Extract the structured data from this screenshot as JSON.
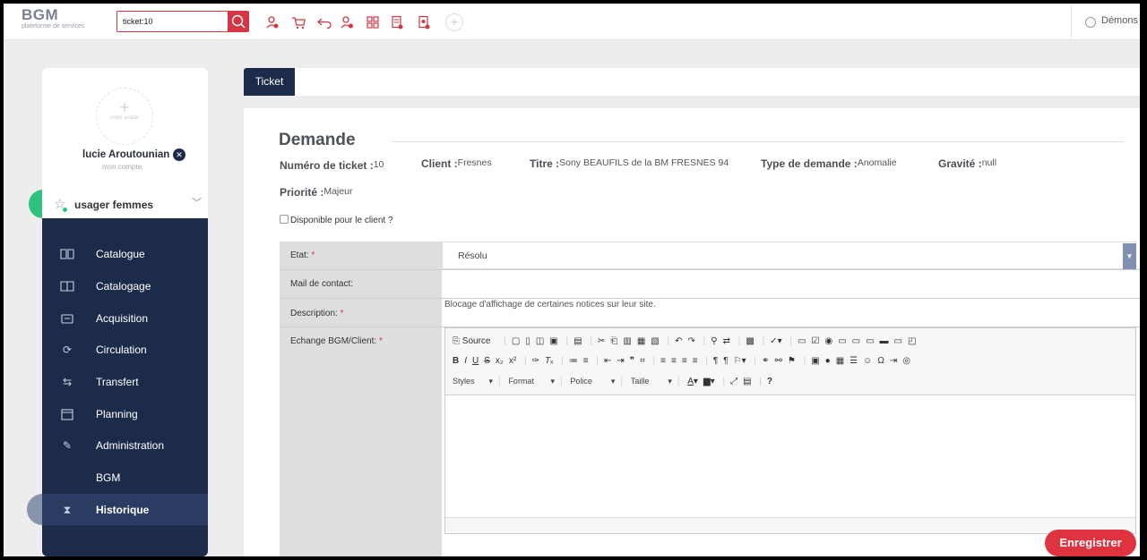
{
  "header": {
    "logo_title": "BGM",
    "logo_subtitle": "plateforme de services",
    "search_value": "ticket:10",
    "user_label": "Démons",
    "colors": {
      "accent": "#d43744",
      "navy": "#1d2b4a"
    }
  },
  "sidebar": {
    "avatar_label": "votre avatar",
    "user_name": "lucie Aroutounian",
    "account_label": "mon compte",
    "profile": "usager femmes",
    "items": [
      {
        "label": "Catalogue",
        "icon": "book-open-icon"
      },
      {
        "label": "Catalogage",
        "icon": "book-icon"
      },
      {
        "label": "Acquisition",
        "icon": "wallet-icon"
      },
      {
        "label": "Circulation",
        "icon": "refresh-icon"
      },
      {
        "label": "Transfert",
        "icon": "transfer-icon"
      },
      {
        "label": "Planning",
        "icon": "calendar-icon"
      },
      {
        "label": "Administration",
        "icon": "pen-icon"
      },
      {
        "label": "BGM",
        "icon": ""
      },
      {
        "label": "Historique",
        "icon": "hourglass-icon"
      }
    ]
  },
  "tabs": {
    "ticket": "Ticket"
  },
  "demande": {
    "title": "Demande",
    "numero_label": "Numéro de ticket :",
    "numero_value": "10",
    "client_label": "Client :",
    "client_value": "Fresnes",
    "titre_label": "Titre :",
    "titre_value": "Sony BEAUFILS de la BM FRESNES 94",
    "type_label": "Type de demande :",
    "type_value": "Anomalie",
    "gravite_label": "Gravité :",
    "gravite_value": "null",
    "priorite_label": "Priorité :",
    "priorite_value": "Majeur",
    "dispo_label": "Disponible pour le client ?"
  },
  "form": {
    "etat_label": "Etat:",
    "etat_value": "Résolu",
    "mail_label": "Mail de contact:",
    "description_label": "Description:",
    "description_value": "Blocage d'affichage de certaines notices sur leur site.",
    "echange_label": "Echange BGM/Client:",
    "required_mark": "*"
  },
  "editor": {
    "source_label": "Source",
    "styles_label": "Styles",
    "format_label": "Format",
    "police_label": "Police",
    "taille_label": "Taille"
  },
  "actions": {
    "save_label": "Enregistrer"
  }
}
